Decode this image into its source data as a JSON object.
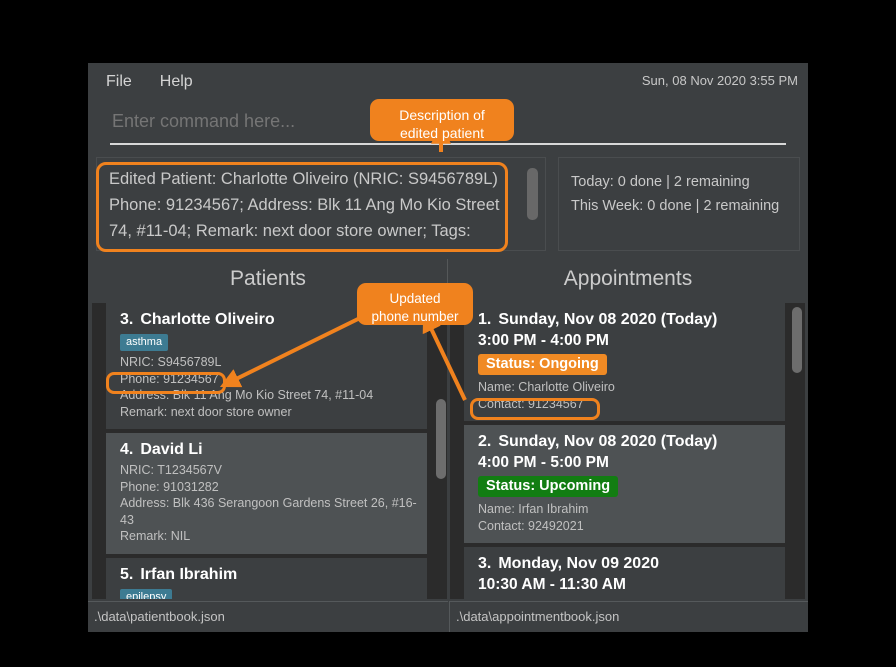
{
  "window": {
    "menu": [
      "File",
      "Help"
    ],
    "clock": "Sun, 08 Nov 2020 3:55 PM"
  },
  "command": {
    "placeholder": "Enter command here...",
    "value": ""
  },
  "result": {
    "text": "Edited Patient: Charlotte Oliveiro (NRIC: S9456789L) Phone: 91234567; Address: Blk 11 Ang Mo Kio Street 74, #11-04; Remark: next door store owner; Tags:"
  },
  "stats": {
    "today": "Today: 0 done | 2 remaining",
    "this_week": "This Week: 0 done | 2 remaining"
  },
  "patients": {
    "title": "Patients",
    "statusbar": ".\\data\\patientbook.json",
    "items": [
      {
        "index": "3.",
        "name": "Charlotte Oliveiro",
        "tags": [
          "asthma"
        ],
        "nric": "NRIC: S9456789L",
        "phone": "Phone: 91234567",
        "address": "Address: Blk 11 Ang Mo Kio Street 74, #11-04",
        "remark": "Remark: next door store owner",
        "selected": false
      },
      {
        "index": "4.",
        "name": "David Li",
        "tags": [],
        "nric": "NRIC: T1234567V",
        "phone": "Phone: 91031282",
        "address": "Address: Blk 436 Serangoon Gardens Street 26, #16-43",
        "remark": "Remark: NIL",
        "selected": true
      },
      {
        "index": "5.",
        "name": "Irfan Ibrahim",
        "tags": [
          "epilepsy"
        ],
        "nric": "",
        "phone": "",
        "address": "",
        "remark": "",
        "selected": false
      }
    ]
  },
  "appointments": {
    "title": "Appointments",
    "statusbar": ".\\data\\appointmentbook.json",
    "items": [
      {
        "index": "1.",
        "date": "Sunday, Nov 08 2020 (Today)",
        "time": "3:00 PM - 4:00 PM",
        "status": "Status: Ongoing",
        "status_kind": "ongoing",
        "name": "Name: Charlotte Oliveiro",
        "contact": "Contact: 91234567",
        "selected": false
      },
      {
        "index": "2.",
        "date": "Sunday, Nov 08 2020 (Today)",
        "time": "4:00 PM - 5:00 PM",
        "status": "Status: Upcoming",
        "status_kind": "upcoming",
        "name": "Name: Irfan Ibrahim",
        "contact": "Contact: 92492021",
        "selected": true
      },
      {
        "index": "3.",
        "date": "Monday, Nov 09 2020",
        "time": "10:30 AM - 11:30 AM",
        "status": "",
        "status_kind": "",
        "name": "",
        "contact": "",
        "selected": false
      }
    ]
  },
  "annotations": {
    "callout_description": "Description of\nedited patient",
    "callout_phone": "Updated\nphone number"
  },
  "colors": {
    "accent_orange": "#f0821e",
    "status_ongoing": "#f08a24",
    "status_upcoming": "#127d12",
    "tag_blue": "#3d7b92",
    "window_bg": "#3c3f41",
    "list_bg": "#2b2b2b"
  }
}
